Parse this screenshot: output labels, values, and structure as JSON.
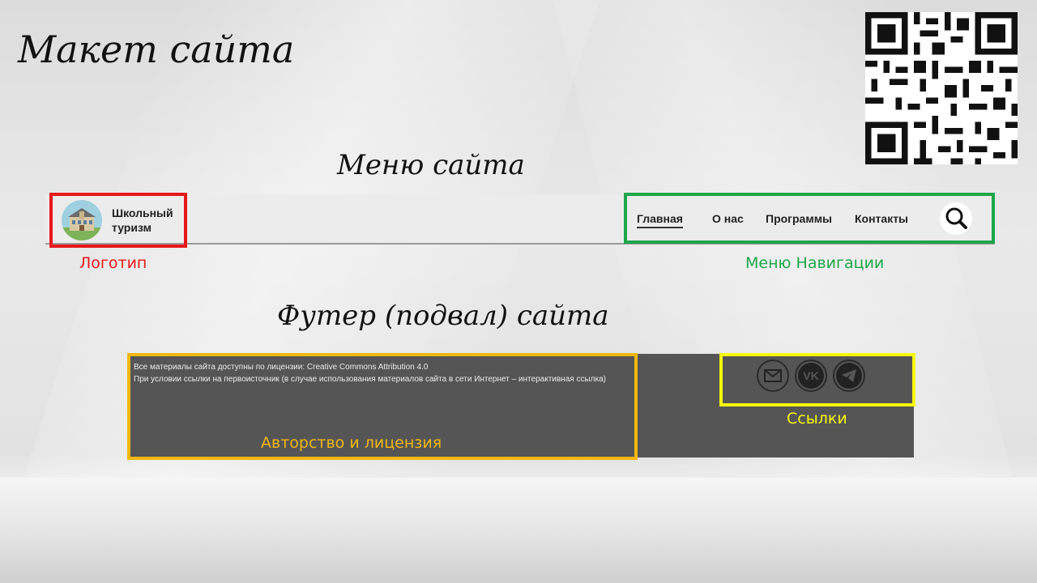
{
  "slide": {
    "title": "Макет сайта",
    "menu_heading": "Меню сайта",
    "footer_heading": "Футер (подвал) сайта"
  },
  "header": {
    "logo_line1": "Школьный",
    "logo_line2": "туризм",
    "nav": [
      {
        "label": "Главная",
        "active": true
      },
      {
        "label": "О нас"
      },
      {
        "label": "Программы"
      },
      {
        "label": "Контакты"
      }
    ],
    "search_icon": "search-icon"
  },
  "annotations": {
    "logo": "Логотип",
    "navigation": "Меню Навигации",
    "license": "Авторство и лицензия",
    "links": "Ссылки"
  },
  "footer": {
    "license_line1": "Все материалы сайта доступны по лицензии: Creative Commons Attribution 4.0",
    "license_line2": "При условии ссылки на первоисточник (в случае использования материалов сайта в сети Интернет – интерактивная ссылка)",
    "social_icons": [
      "mail-icon",
      "vk-icon",
      "telegram-icon"
    ]
  },
  "colors": {
    "logo_box": "#e8171b",
    "nav_box": "#1ea64a",
    "license_box": "#f2b80f",
    "links_box": "#f6f90a",
    "footer_bg": "#555555"
  }
}
